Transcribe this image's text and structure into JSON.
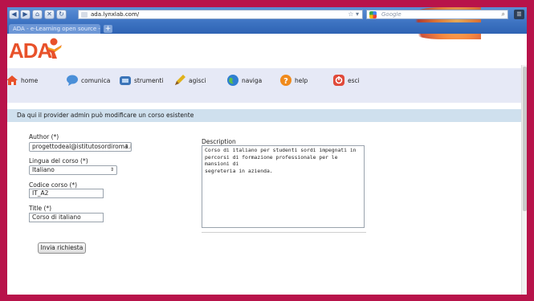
{
  "browser": {
    "url": "ada.lynxlab.com/",
    "search_placeholder": "Google",
    "tab_title": "ADA - e-Learning open source - Home",
    "new_tab": "+"
  },
  "logo": {
    "text": "ADA"
  },
  "menu": [
    {
      "label": "home",
      "icon": "home-icon",
      "color": "#e8512a"
    },
    {
      "label": "comunica",
      "icon": "chat-bubble-icon",
      "color": "#4a8fd8"
    },
    {
      "label": "strumenti",
      "icon": "tools-icon",
      "color": "#3a74b8"
    },
    {
      "label": "agisci",
      "icon": "pencil-icon",
      "color": "#e0b21a"
    },
    {
      "label": "naviga",
      "icon": "globe-icon",
      "color": "#2f7fd0"
    },
    {
      "label": "help",
      "icon": "help-icon",
      "color": "#f08a1c"
    },
    {
      "label": "esci",
      "icon": "exit-icon",
      "color": "#e04a3a"
    }
  ],
  "info": "Da qui il provider admin può modificare un corso esistente",
  "form": {
    "author_label": "Author (*)",
    "author_value": "progettodeal@istitutosordiroma.it",
    "lingua_label": "Lingua del corso (*)",
    "lingua_value": "Italiano",
    "codice_label": "Codice corso (*)",
    "codice_value": "IT_A2",
    "title_label": "Title (*)",
    "title_value": "Corso di italiano",
    "description_label": "Description",
    "description_value": "Corso di italiano per studenti sordi impegnati in\npercorsi di formazione professionale per le mansioni di\nsegreteria in azienda.",
    "submit_label": "Invia richiesta"
  }
}
